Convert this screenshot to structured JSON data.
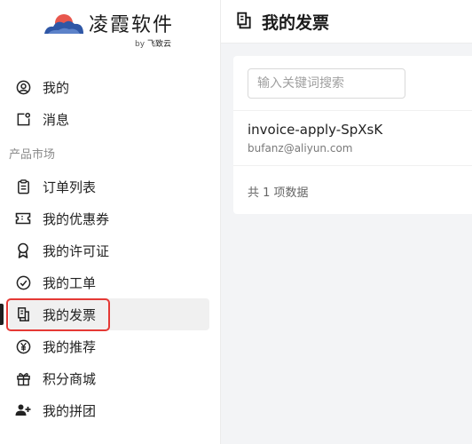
{
  "app": {
    "logo_text": "凌霞软件",
    "by_label": "by",
    "by_brand": "飞致云"
  },
  "sidebar": {
    "top_items": [
      {
        "label": "我的",
        "icon": "user-circle-icon"
      },
      {
        "label": "消息",
        "icon": "message-icon"
      }
    ],
    "section_title": "产品市场",
    "items": [
      {
        "label": "订单列表",
        "icon": "clipboard-icon"
      },
      {
        "label": "我的优惠券",
        "icon": "coupon-icon"
      },
      {
        "label": "我的许可证",
        "icon": "award-icon"
      },
      {
        "label": "我的工单",
        "icon": "check-circle-icon"
      },
      {
        "label": "我的发票",
        "icon": "invoice-icon",
        "active": true
      },
      {
        "label": "我的推荐",
        "icon": "yen-circle-icon"
      },
      {
        "label": "积分商城",
        "icon": "gift-icon"
      },
      {
        "label": "我的拼团",
        "icon": "group-add-icon"
      }
    ]
  },
  "header": {
    "title": "我的发票",
    "icon": "invoice-icon"
  },
  "main": {
    "search_placeholder": "输入关键词搜索",
    "rows": [
      {
        "name": "invoice-apply-SpXsK",
        "email": "bufanz@aliyun.com"
      }
    ],
    "count_text": "共 1 项数据"
  },
  "colors": {
    "highlight": "#e53935",
    "logo_sun": "#e8574d",
    "logo_cloud": "#2f57a6"
  }
}
